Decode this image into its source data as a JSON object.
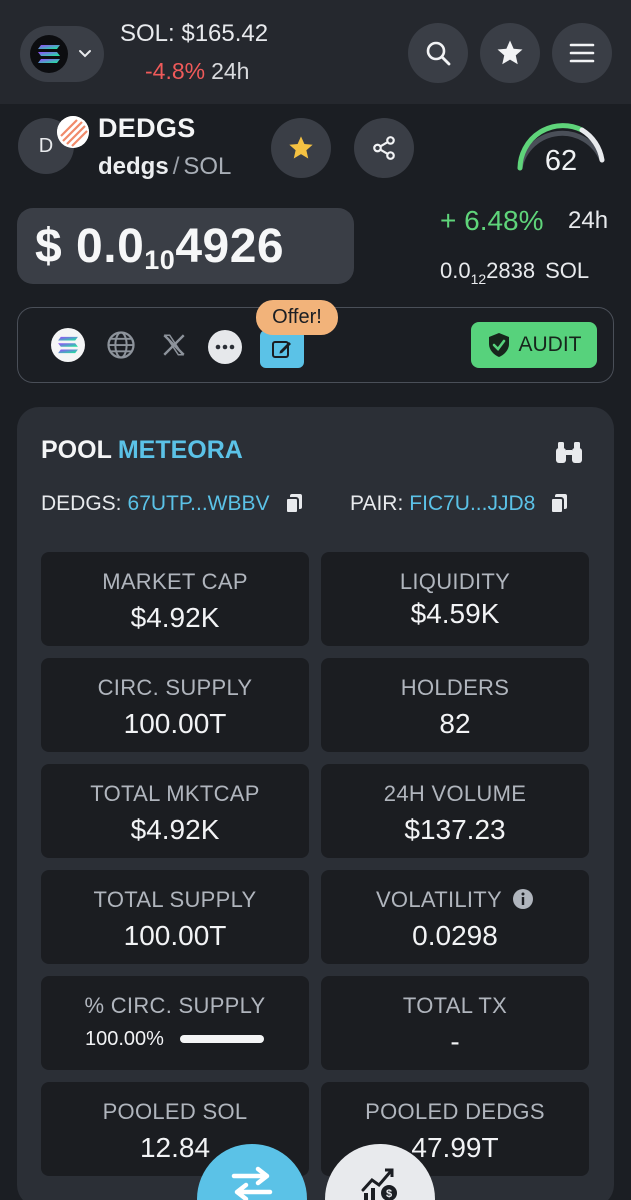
{
  "header": {
    "sol_price": "SOL: $165.42",
    "sol_change": "-4.8%",
    "sol_change_period": "24h",
    "icons": [
      "solana-icon",
      "chevron-down-icon",
      "search-icon",
      "star-icon",
      "menu-icon"
    ]
  },
  "token": {
    "avatar_letter": "D",
    "name": "DEDGS",
    "symbol": "dedgs",
    "separator": "/",
    "quote": "SOL",
    "score": "62",
    "price_prefix": "$ 0.0",
    "price_zeros": "10",
    "price_digits": "4926",
    "change": "+ 6.48%",
    "change_period": "24h",
    "price_sol_prefix": "0.0",
    "price_sol_zeros": "12",
    "price_sol_digits": "2838",
    "price_sol_unit": "SOL"
  },
  "links": {
    "offer_label": "Offer!",
    "audit_label": "AUDIT",
    "icons": [
      "solana-icon",
      "globe-icon",
      "x-icon",
      "more-icon",
      "edit-icon",
      "shield-check-icon"
    ]
  },
  "pool": {
    "label": "POOL",
    "dex": "METEORA",
    "token_label": "DEDGS:",
    "token_address": "67UTP...WBBV",
    "pair_label": "PAIR:",
    "pair_address": "FIC7U...JJD8",
    "stats": [
      {
        "label": "MARKET CAP",
        "value": "$4.92K"
      },
      {
        "label": "LIQUIDITY",
        "value": "$4.59K"
      },
      {
        "label": "CIRC. SUPPLY",
        "value": "100.00T"
      },
      {
        "label": "HOLDERS",
        "value": "82"
      },
      {
        "label": "TOTAL MKTCAP",
        "value": "$4.92K"
      },
      {
        "label": "24H VOLUME",
        "value": "$137.23"
      },
      {
        "label": "TOTAL SUPPLY",
        "value": "100.00T"
      },
      {
        "label": "VOLATILITY",
        "value": "0.0298"
      },
      {
        "label": "% CIRC. SUPPLY",
        "value": "100.00%"
      },
      {
        "label": "TOTAL TX",
        "value": "-"
      },
      {
        "label": "POOLED SOL",
        "value": "12.84"
      },
      {
        "label": "POOLED DEDGS",
        "value": "47.99T"
      }
    ],
    "circ_supply_fraction": 1.0
  },
  "colors": {
    "accent_blue": "#5bc2e7",
    "positive": "#5fd47a",
    "negative": "#ef5a5a",
    "offer": "#f2b37a",
    "audit": "#57d27c"
  },
  "fabs": [
    "swap-icon",
    "chart-dollar-icon"
  ]
}
